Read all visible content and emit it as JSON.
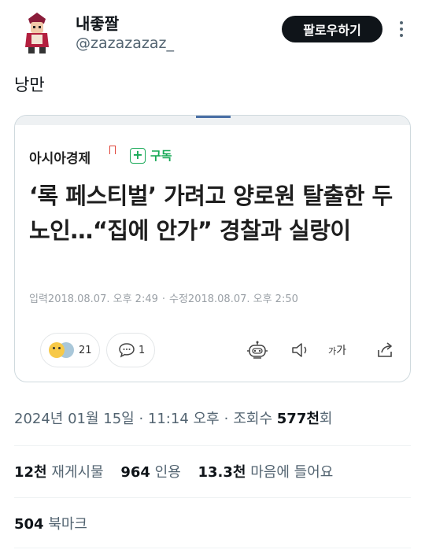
{
  "author": {
    "display_name": "내좋짤",
    "handle": "@zazazazaz_",
    "follow_label": "팔로우하기"
  },
  "tweet": {
    "text": "낭만"
  },
  "card": {
    "publisher": "아시아경제",
    "subscribe_label": "구독",
    "headline": "‘록 페스티벌’ 가려고 양로원 탈출한 두 노인…“집에 안가” 경찰과 실랑이",
    "input_date": "입력2018.08.07. 오후 2:49",
    "edit_date": "수정2018.08.07. 오후 2:50",
    "date_separator": "·",
    "reaction_count": "21",
    "comment_count": "1",
    "font_button_label_small": "가",
    "font_button_label_large": "가"
  },
  "meta": {
    "timestamp": "2024년 01월 15일 · 11:14 오후",
    "views_label": "조회수",
    "views_count": "577천",
    "views_suffix": "회"
  },
  "stats": {
    "retweets_count": "12천",
    "retweets_label": "재게시물",
    "quotes_count": "964",
    "quotes_label": "인용",
    "likes_count": "13.3천",
    "likes_label": "마음에 들어요",
    "bookmarks_count": "504",
    "bookmarks_label": "북마크"
  },
  "colors": {
    "follow_bg": "#0f1419",
    "subscribe_green": "#18a957",
    "secondary_text": "#536471"
  },
  "icons": [
    "more-icon",
    "plus-icon",
    "emoji-reaction-icon",
    "comment-icon",
    "robot-icon",
    "speaker-icon",
    "share-icon"
  ]
}
